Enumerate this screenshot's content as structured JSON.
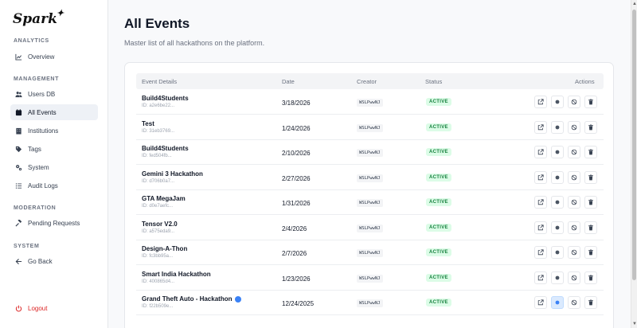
{
  "app": {
    "logo": "Spark"
  },
  "sidebar": {
    "sections": [
      {
        "label": "ANALYTICS",
        "items": [
          {
            "label": "Overview",
            "icon": "chart-line-icon"
          }
        ]
      },
      {
        "label": "MANAGEMENT",
        "items": [
          {
            "label": "Users DB",
            "icon": "users-icon"
          },
          {
            "label": "All Events",
            "icon": "calendar-icon",
            "active": true
          },
          {
            "label": "Institutions",
            "icon": "building-icon"
          },
          {
            "label": "Tags",
            "icon": "tag-icon"
          },
          {
            "label": "System",
            "icon": "gears-icon"
          },
          {
            "label": "Audit Logs",
            "icon": "list-icon"
          }
        ]
      },
      {
        "label": "MODERATION",
        "items": [
          {
            "label": "Pending Requests",
            "icon": "gavel-icon"
          }
        ]
      },
      {
        "label": "SYSTEM",
        "items": [
          {
            "label": "Go Back",
            "icon": "arrow-left-icon"
          }
        ]
      }
    ],
    "logout": {
      "label": "Logout",
      "icon": "power-icon"
    }
  },
  "main": {
    "title": "All Events",
    "subtitle": "Master list of all hackathons on the platform.",
    "table": {
      "columns": [
        "Event Details",
        "Date",
        "Creator",
        "Status",
        "Actions"
      ],
      "rows": [
        {
          "name": "Build4Students",
          "id": "ID: a2e6be22...",
          "date": "3/18/2026",
          "creator": "WSLPwwNJ",
          "status": "ACTIVE"
        },
        {
          "name": "Test",
          "id": "ID: 31eb3769...",
          "date": "1/24/2026",
          "creator": "WSLPwwNJ",
          "status": "ACTIVE"
        },
        {
          "name": "Build4Students",
          "id": "ID: fed504fb...",
          "date": "2/10/2026",
          "creator": "WSLPwwNJ",
          "status": "ACTIVE"
        },
        {
          "name": "Gemini 3 Hackathon",
          "id": "ID: d706b0a7...",
          "date": "2/27/2026",
          "creator": "WSLPwwNJ",
          "status": "ACTIVE"
        },
        {
          "name": "GTA MegaJam",
          "id": "ID: d0e7aefc...",
          "date": "1/31/2026",
          "creator": "WSLPwwNJ",
          "status": "ACTIVE"
        },
        {
          "name": "Tensor V2.0",
          "id": "ID: a575eda9...",
          "date": "2/4/2026",
          "creator": "WSLPwwNJ",
          "status": "ACTIVE"
        },
        {
          "name": "Design-A-Thon",
          "id": "ID: fc3bb95a...",
          "date": "2/7/2026",
          "creator": "WSLPwwNJ",
          "status": "ACTIVE"
        },
        {
          "name": "Smart India Hackathon",
          "id": "ID: 400865d4...",
          "date": "1/23/2026",
          "creator": "WSLPwwNJ",
          "status": "ACTIVE"
        },
        {
          "name": "Grand Theft Auto - Hackathon",
          "id": "ID: f22b509e...",
          "date": "12/24/2025",
          "creator": "WSLPwwNJ",
          "status": "ACTIVE",
          "verified": true,
          "featured_highlight": true
        }
      ],
      "action_icons": [
        "external-link-icon",
        "feature-dot-icon",
        "ban-icon",
        "trash-icon"
      ]
    }
  },
  "colors": {
    "accent": "#3b82f6",
    "active_green": "#15803d",
    "active_bg": "#dcfce7",
    "danger": "#dc2626"
  }
}
